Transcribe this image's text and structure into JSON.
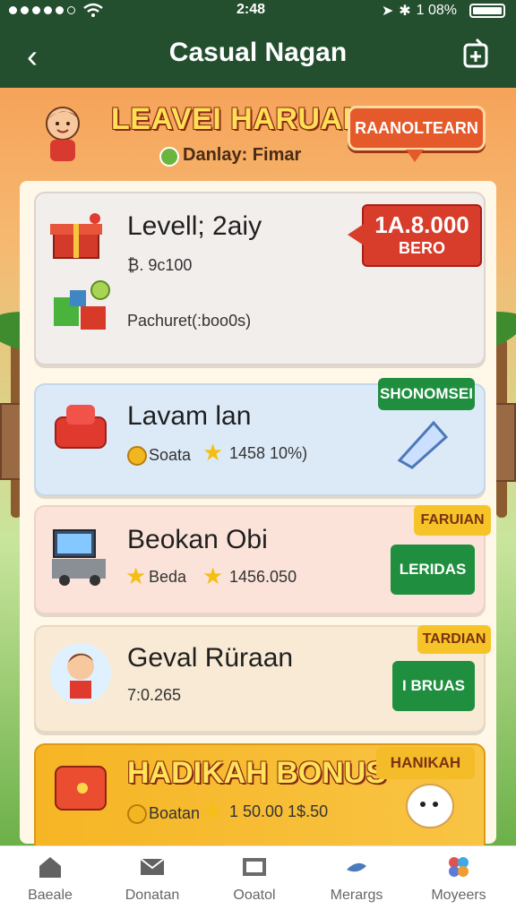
{
  "status_bar": {
    "time": "2:48",
    "battery": "1 08%"
  },
  "nav": {
    "title": "Casual Nagan",
    "back_icon": "chevron-left-icon",
    "share_icon": "share-icon"
  },
  "banner": {
    "title": "LEAVEI HARUAN",
    "subtitle": "Danlay: Fimar",
    "cta": "RAANOLTEARN"
  },
  "cards": [
    {
      "name": "Levell; 2aiy",
      "meta": "₿. 9c100",
      "secondary": "Pachuret(:boo0s)",
      "price": "1A.8.000",
      "price_sub": "BERO"
    },
    {
      "name": "Lavam lan",
      "meta1": "Soata",
      "meta2": "1458 10%)",
      "tag": "SHONOMSEI"
    },
    {
      "name": "Beokan Obi",
      "meta1": "Beda",
      "meta2": "1456.050",
      "tag_top": "FARUIAN",
      "tag": "LERIDAS"
    },
    {
      "name": "Geval Rüraan",
      "meta": "7:0.265",
      "tag_top": "TARDIAN",
      "tag": "I BRUAS"
    },
    {
      "name": "HADIKAH BONUS",
      "meta1": "Boatan",
      "meta2": "1 50.00 1$.50",
      "tag": "HANIKAH"
    }
  ],
  "bottom_nav": [
    {
      "label": "Baeale",
      "icon": "home-icon"
    },
    {
      "label": "Donatan",
      "icon": "mail-icon"
    },
    {
      "label": "Ooatol",
      "icon": "window-icon"
    },
    {
      "label": "Merargs",
      "icon": "fish-icon"
    },
    {
      "label": "Moyeers",
      "icon": "dots-icon"
    }
  ],
  "colors": {
    "header": "#234f2f",
    "accent": "#e55a2b",
    "gold": "#f4be14",
    "green": "#1f8e3f"
  }
}
